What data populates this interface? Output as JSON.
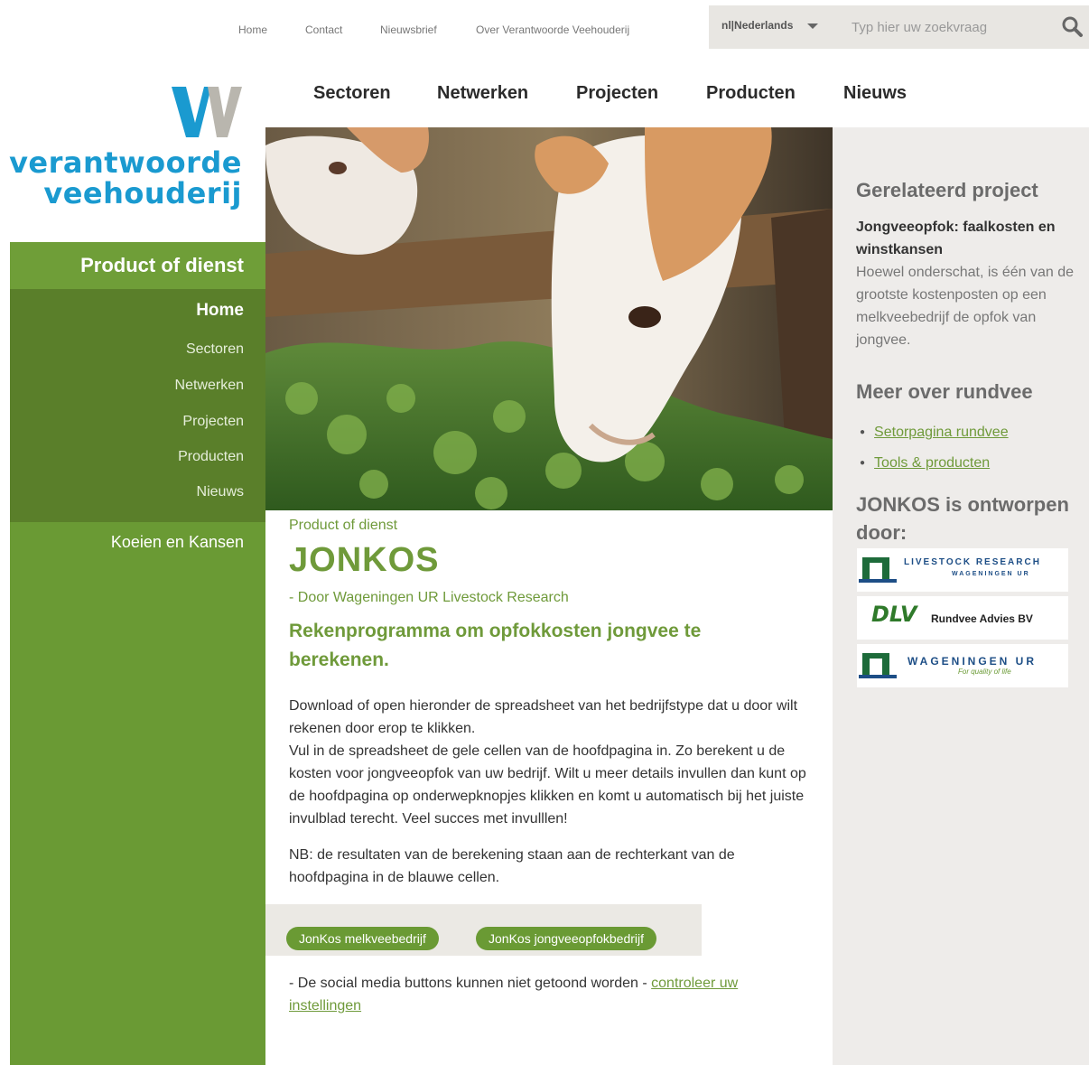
{
  "topnav": {
    "links": [
      "Home",
      "Contact",
      "Nieuwsbrief",
      "Over Verantwoorde Veehouderij"
    ],
    "language": "nl|Nederlands",
    "search_placeholder": "Typ hier uw zoekvraag"
  },
  "logo": {
    "line1": "verantwoorde",
    "line2": "veehouderij"
  },
  "mainnav": [
    "Sectoren",
    "Netwerken",
    "Projecten",
    "Producten",
    "Nieuws"
  ],
  "sidebar": {
    "title": "Product of dienst",
    "items": [
      "Home",
      "Sectoren",
      "Netwerken",
      "Projecten",
      "Producten",
      "Nieuws"
    ],
    "active": "Home",
    "extra": "Koeien en Kansen"
  },
  "content": {
    "breadcrumb": "Product of dienst",
    "title": "JONKOS",
    "byline": "- Door Wageningen UR Livestock Research",
    "lead": "Rekenprogramma om opfokkosten jongvee te berekenen.",
    "paragraph1": "Download of open hieronder de spreadsheet van het bedrijfstype dat u door wilt rekenen door erop te klikken.",
    "paragraph1b": "Vul in de spreadsheet de gele cellen van de hoofdpagina in. Zo berekent u de kosten voor jongveeopfok van uw bedrijf. Wilt u meer details invullen dan kunt op de hoofdpagina op onderwepknopjes klikken en komt u automatisch bij het juiste invulblad terecht. Veel succes met invulllen!",
    "paragraph2": "NB: de resultaten van de berekening staan aan de rechterkant van de hoofdpagina in de blauwe cellen.",
    "buttons": [
      "JonKos melkveebedrijf",
      "JonKos jongveeopfokbedrijf"
    ],
    "social_text": "- De social media buttons kunnen niet getoond worden - ",
    "social_link": "controleer uw instellingen"
  },
  "aside": {
    "related_heading": "Gerelateerd project",
    "related_title": "Jongveeopfok: faalkosten en winstkansen",
    "related_text": "Hoewel onderschat, is één van de grootste kostenposten op een melkveebedrijf de opfok van jongvee.",
    "more_heading": "Meer over rundvee",
    "more_links": [
      "Setorpagina rundvee",
      "Tools & producten"
    ],
    "designed_heading": "JONKOS is ontworpen door:",
    "partners": [
      {
        "name": "LIVESTOCK RESEARCH",
        "sub": "WAGENINGEN UR"
      },
      {
        "name": "DLV",
        "sub": "Rundvee Advies BV"
      },
      {
        "name": "WAGENINGEN UR",
        "sub": "For quality of life"
      }
    ]
  },
  "colors": {
    "brand_green": "#6a9a34",
    "dark_green": "#5a7f2a",
    "brand_blue": "#1a9ad0"
  }
}
